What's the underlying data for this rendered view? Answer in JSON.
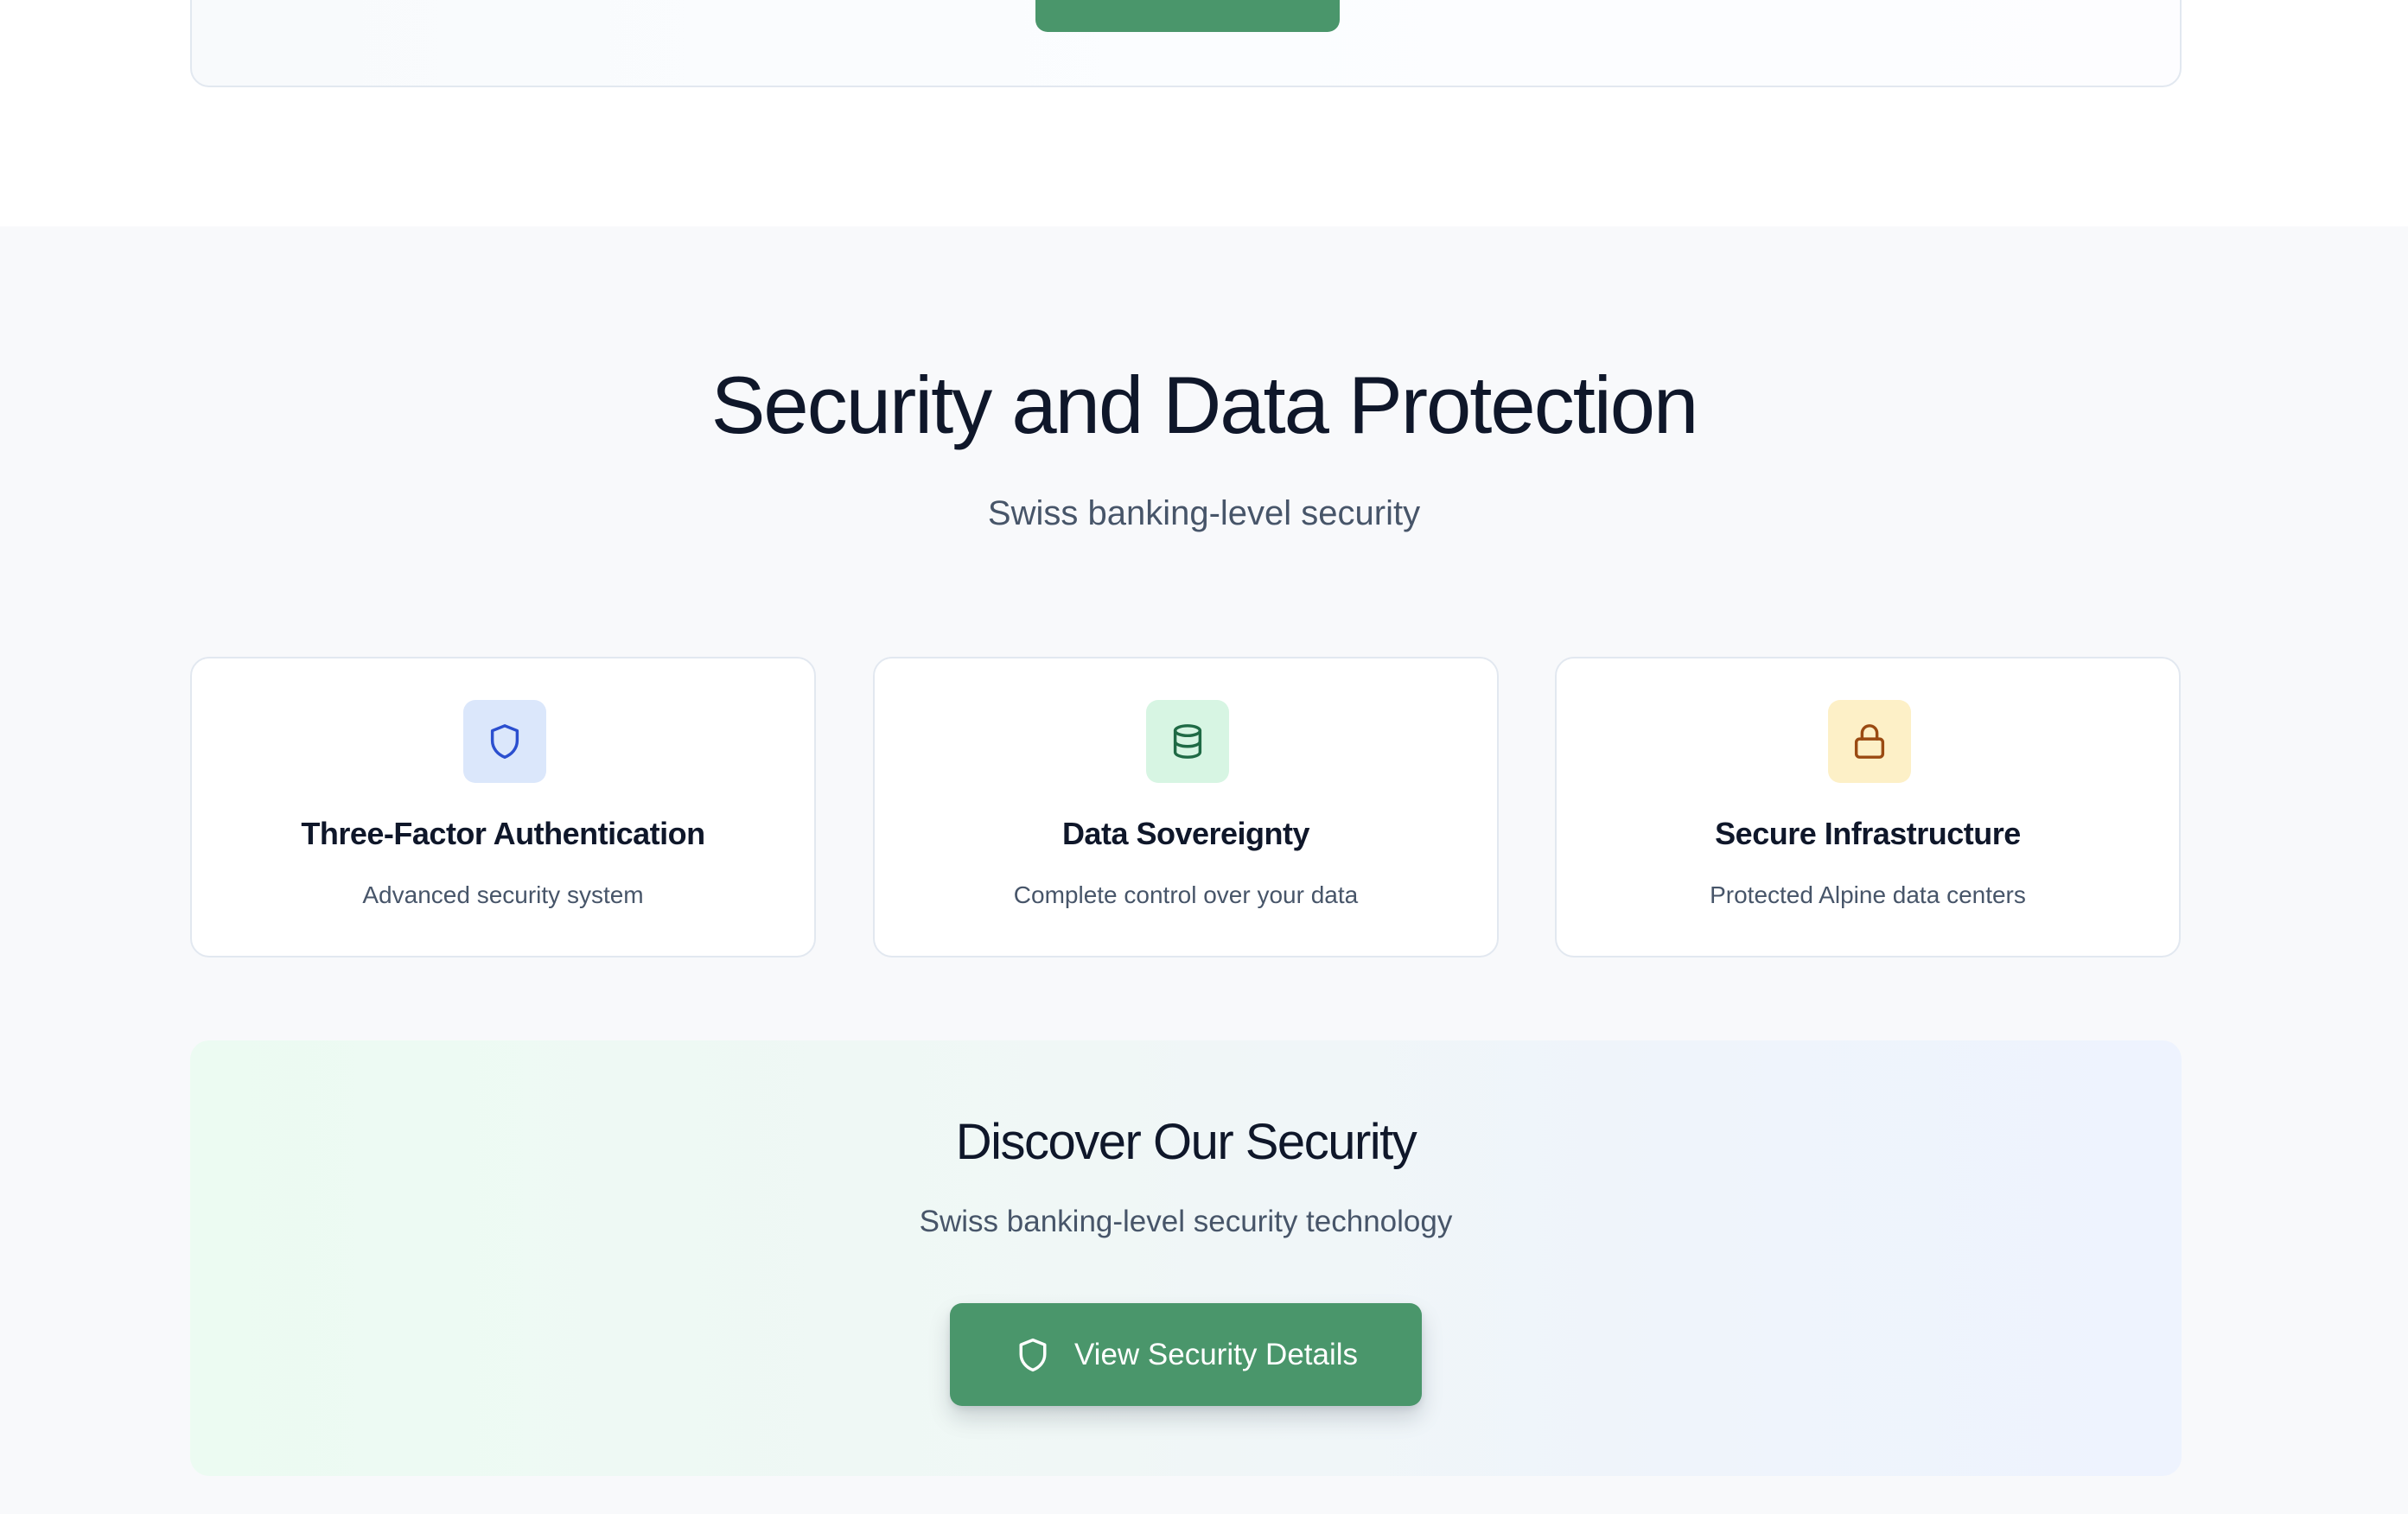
{
  "security": {
    "title": "Security and Data Protection",
    "subtitle": "Swiss banking-level security",
    "features": [
      {
        "icon": "shield-icon",
        "title": "Three-Factor Authentication",
        "description": "Advanced security system",
        "accent": "#2b4fcf",
        "tint": "#dbe7fb"
      },
      {
        "icon": "database-icon",
        "title": "Data Sovereignty",
        "description": "Complete control over your data",
        "accent": "#1f6a45",
        "tint": "#d7f5e3"
      },
      {
        "icon": "lock-icon",
        "title": "Secure Infrastructure",
        "description": "Protected Alpine data centers",
        "accent": "#9a4a12",
        "tint": "#fdf0c7"
      }
    ]
  },
  "cta": {
    "title": "Discover Our Security",
    "subtitle": "Swiss banking-level security technology",
    "button_label": "View Security Details",
    "button_icon": "shield-icon"
  },
  "colors": {
    "primary_green": "#4a966b",
    "section_background": "#f8f9fb",
    "heading": "#0f172a",
    "muted_text": "#475569",
    "border": "#e2e8f0"
  }
}
